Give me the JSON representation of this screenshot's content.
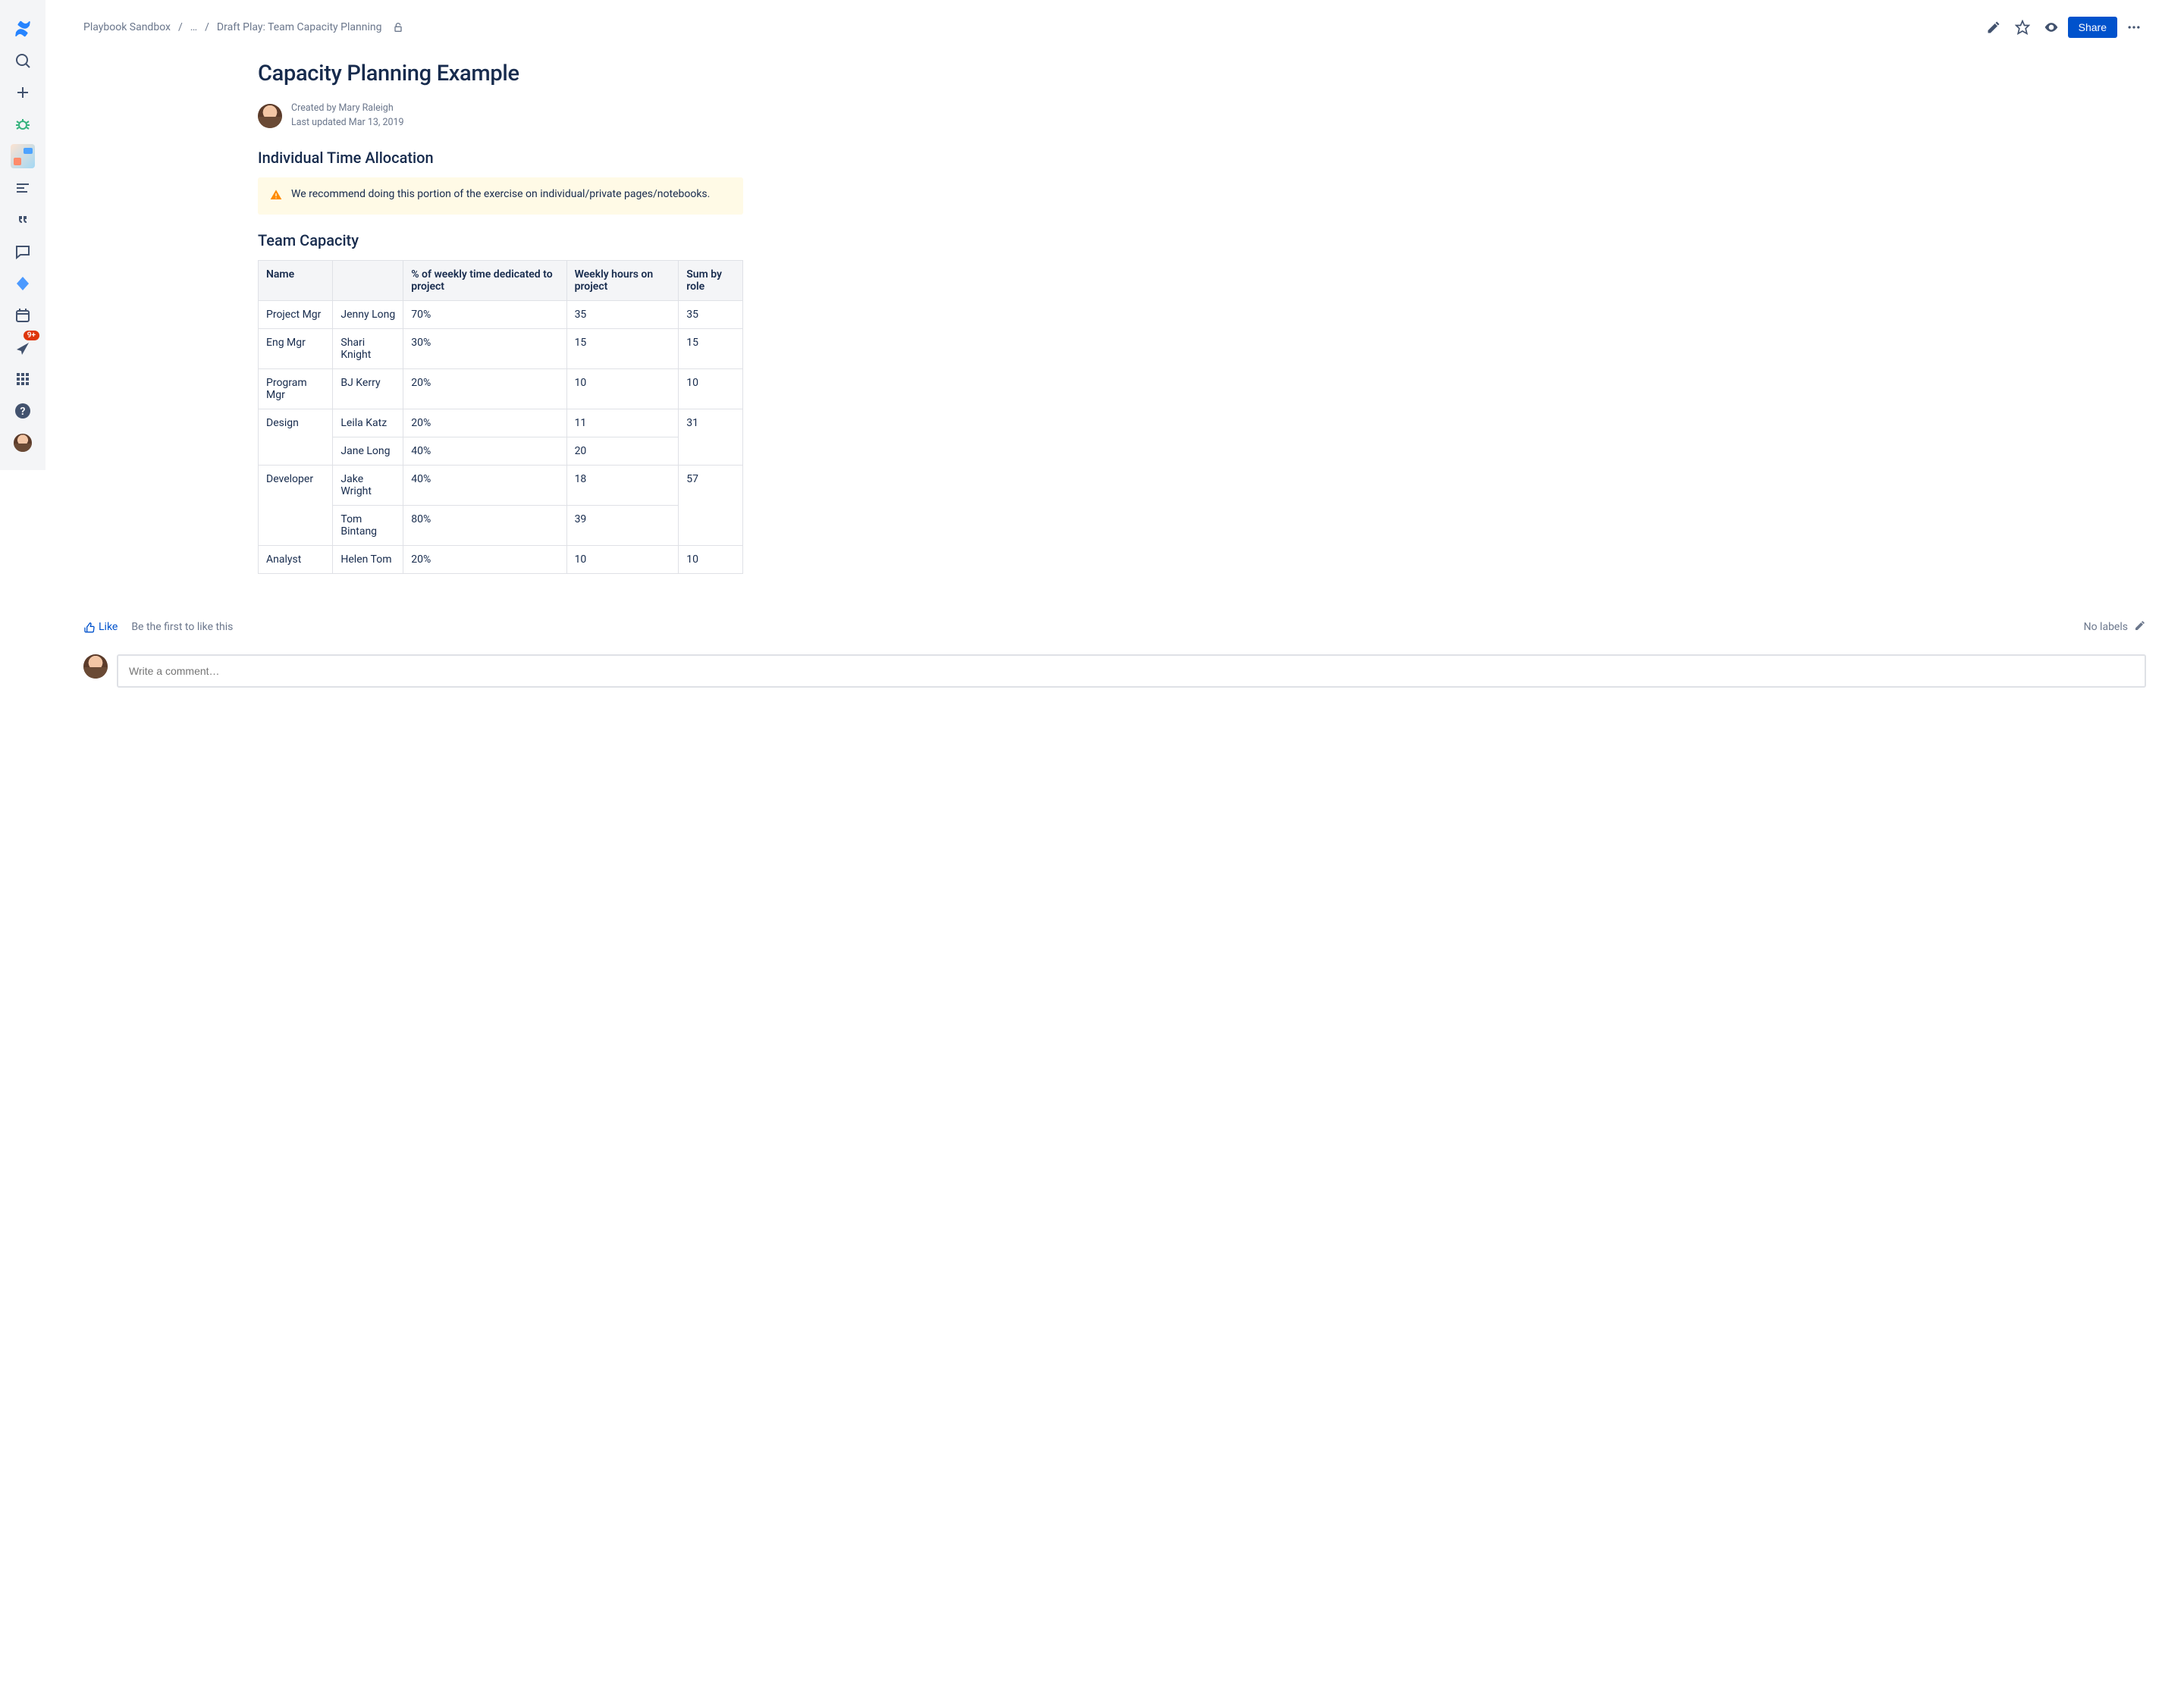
{
  "breadcrumbs": {
    "space": "Playbook Sandbox",
    "ellipsis": "…",
    "page": "Draft Play: Team Capacity Planning"
  },
  "actions": {
    "share": "Share"
  },
  "sidebar": {
    "notification_badge": "9+"
  },
  "page": {
    "title": "Capacity Planning Example",
    "created_by": "Created by Mary Raleigh",
    "last_updated": "Last updated Mar 13, 2019",
    "section_individual": "Individual Time Allocation",
    "warning_text": "We recommend doing this portion of the exercise on individual/private pages/notebooks.",
    "section_team": "Team Capacity"
  },
  "table": {
    "headers": {
      "name": "Name",
      "blank": "",
      "percent": "% of weekly time dedicated to project",
      "hours": "Weekly hours on project",
      "sum": "Sum by role"
    },
    "rows": {
      "r0": {
        "role": "Project Mgr",
        "person": "Jenny Long",
        "pct": "70%",
        "hrs": "35",
        "sum": "35"
      },
      "r1": {
        "role": "Eng Mgr",
        "person": "Shari Knight",
        "pct": "30%",
        "hrs": "15",
        "sum": "15"
      },
      "r2": {
        "role": "Program Mgr",
        "person": "BJ Kerry",
        "pct": "20%",
        "hrs": "10",
        "sum": "10"
      },
      "r3": {
        "role": "Design",
        "person": "Leila Katz",
        "pct": "20%",
        "hrs": "11",
        "sum": "31"
      },
      "r4": {
        "person": "Jane Long",
        "pct": "40%",
        "hrs": "20"
      },
      "r5": {
        "role": "Developer",
        "person": "Jake Wright",
        "pct": "40%",
        "hrs": "18",
        "sum": "57"
      },
      "r6": {
        "person": "Tom Bintang",
        "pct": "80%",
        "hrs": "39"
      },
      "r7": {
        "role": "Analyst",
        "person": "Helen Tom",
        "pct": "20%",
        "hrs": "10",
        "sum": "10"
      }
    }
  },
  "footer": {
    "like": "Like",
    "like_note": "Be the first to like this",
    "no_labels": "No labels",
    "comment_placeholder": "Write a comment…"
  }
}
